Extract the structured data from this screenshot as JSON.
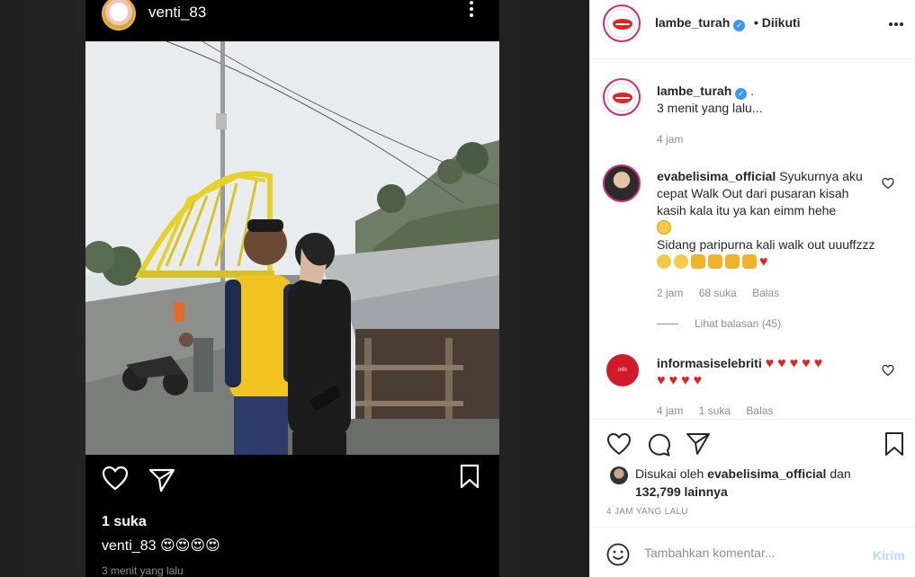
{
  "story": {
    "username": "venti_83",
    "likes": "1 suka",
    "caption_user": "venti_83",
    "caption_emojis": "😍😍😍😍",
    "time": "3 menit yang lalu"
  },
  "post": {
    "author": "lambe_turah",
    "follow_status": "• Diikuti",
    "caption_user": "lambe_turah",
    "caption_text": ".",
    "caption_line2": "3 menit yang lalu...",
    "caption_time": "4 jam",
    "comments": [
      {
        "user": "evabelisima_official",
        "text": "Syukurnya aku cepat Walk Out dari pusaran kisah kasih kala itu ya kan eimm hehe",
        "text2": "Sidang paripurna kali walk out uuuffzzz",
        "time": "2 jam",
        "likes": "68 suka",
        "reply": "Balas",
        "view_replies": "Lihat balasan (45)"
      },
      {
        "user": "informasiselebriti",
        "hearts_line1": "♥♥♥♥♥",
        "hearts_line2": "♥♥♥♥",
        "time": "4 jam",
        "likes": "1 suka",
        "reply": "Balas"
      }
    ],
    "liked_by_prefix": "Disukai oleh",
    "liked_by_user": "evabelisima_official",
    "liked_by_and": "dan",
    "liked_by_count": "132,799 lainnya",
    "date": "4 JAM YANG LALU",
    "add_comment_placeholder": "Tambahkan komentar...",
    "post_button": "Kirim"
  },
  "colors": {
    "accent_blue": "#3897f0",
    "heart_red": "#e02424",
    "muted": "#8e8e8e"
  }
}
